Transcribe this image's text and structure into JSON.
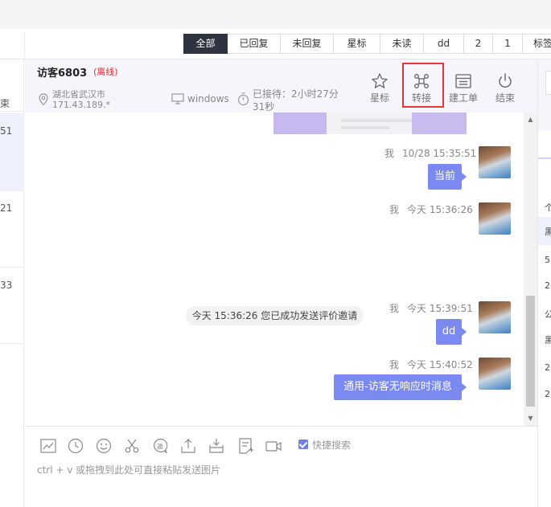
{
  "filter_tabs": [
    {
      "label": "全部",
      "active": true
    },
    {
      "label": "已回复",
      "active": false
    },
    {
      "label": "未回复",
      "active": false
    },
    {
      "label": "星标",
      "active": false
    },
    {
      "label": "未读",
      "active": false
    },
    {
      "label": "dd",
      "active": false
    },
    {
      "label": "2",
      "active": false
    },
    {
      "label": "1",
      "active": false
    },
    {
      "label": "标签",
      "active": false
    }
  ],
  "left_list": {
    "end_label": "束",
    "items": [
      "51",
      "21",
      "33"
    ]
  },
  "visitor": {
    "name": "访客6803",
    "status": "(离线)",
    "location_line1": "湖北省武汉市",
    "location_line2": "171.43.189.*",
    "os": "windows",
    "wait_line1": "已接待：2小时27分",
    "wait_line2": "31秒"
  },
  "actions": [
    {
      "label": "星标",
      "icon": "star-icon"
    },
    {
      "label": "转接",
      "icon": "transfer-icon"
    },
    {
      "label": "建工单",
      "icon": "ticket-icon"
    },
    {
      "label": "结束",
      "icon": "power-icon"
    }
  ],
  "messages": [
    {
      "sender": "我",
      "time": "10/28 15:35:51",
      "text": "当前"
    },
    {
      "sender": "我",
      "time": "今天 15:36:26",
      "text": ""
    },
    {
      "sender": "我",
      "time": "今天 15:39:51",
      "text": "dd"
    },
    {
      "sender": "我",
      "time": "今天 15:40:52",
      "text": "通用-访客无响应时消息"
    }
  ],
  "system_notice": "今天 15:36:26 您已成功发送评价邀请",
  "toolbar_icons": [
    "chart-icon",
    "clock-icon",
    "emoji-icon",
    "scissors-icon",
    "invite-icon",
    "upload-icon",
    "download-icon",
    "note-icon",
    "video-icon"
  ],
  "quick_search_label": "快捷搜索",
  "input_placeholder": "ctrl + v 或拖拽到此处可直接粘贴发送图片",
  "right_fragment_chars": [
    "个",
    "黑",
    "5",
    "2",
    "公",
    "黑",
    "2",
    "2"
  ],
  "colors": {
    "accent": "#7b8af0",
    "tab_active": "#2f3340",
    "offline": "#e03131",
    "highlight_box": "#e53935"
  }
}
